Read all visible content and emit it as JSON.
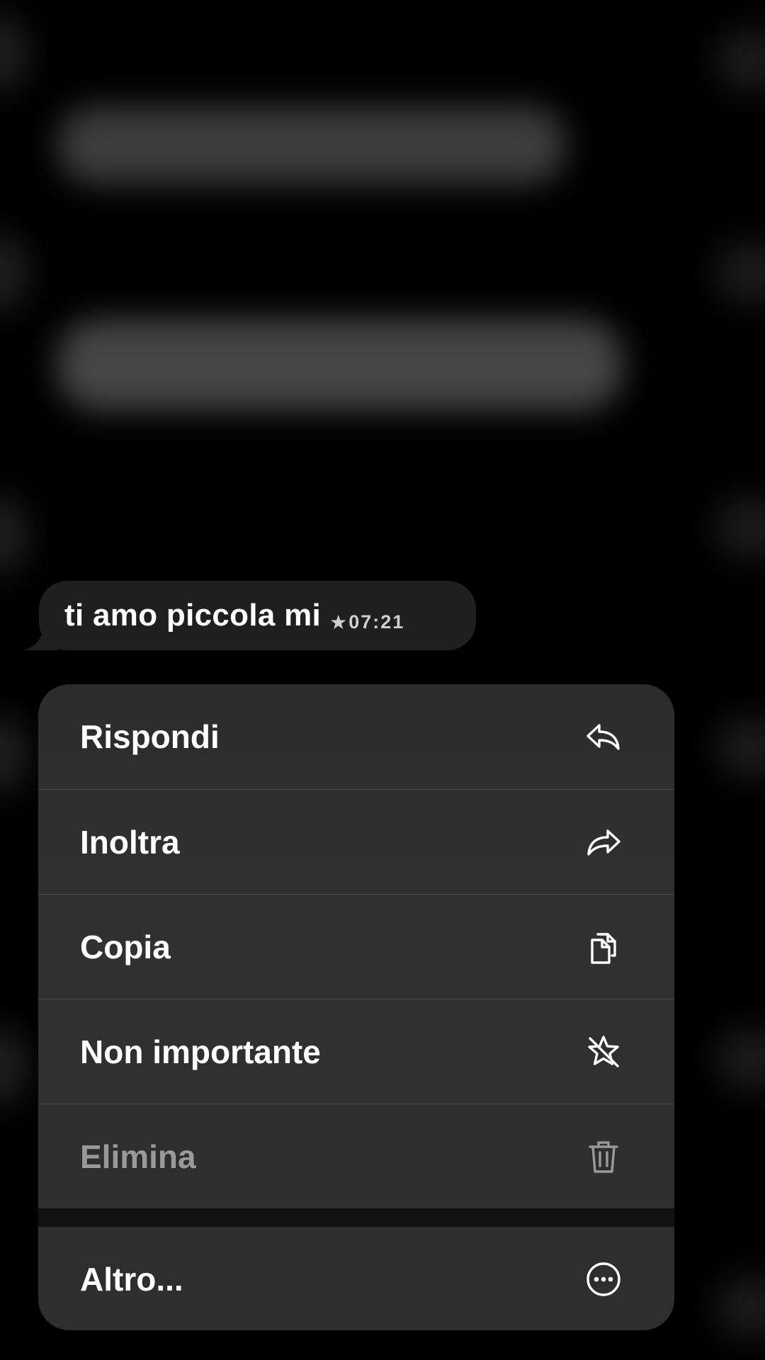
{
  "message": {
    "text": "ti amo piccola mi",
    "starred_icon": "star-icon",
    "time": "07:21"
  },
  "menu": {
    "items": [
      {
        "label": "Rispondi",
        "icon": "reply-icon",
        "enabled": true
      },
      {
        "label": "Inoltra",
        "icon": "forward-icon",
        "enabled": true
      },
      {
        "label": "Copia",
        "icon": "copy-icon",
        "enabled": true
      },
      {
        "label": "Non importante",
        "icon": "unstar-icon",
        "enabled": true
      },
      {
        "label": "Elimina",
        "icon": "trash-icon",
        "enabled": false
      }
    ],
    "more": {
      "label": "Altro...",
      "icon": "more-icon"
    }
  },
  "colors": {
    "background": "#000000",
    "bubble": "#1f1f1f",
    "menu": "#2e2e2e",
    "disabled_text": "#9a9a9a"
  }
}
